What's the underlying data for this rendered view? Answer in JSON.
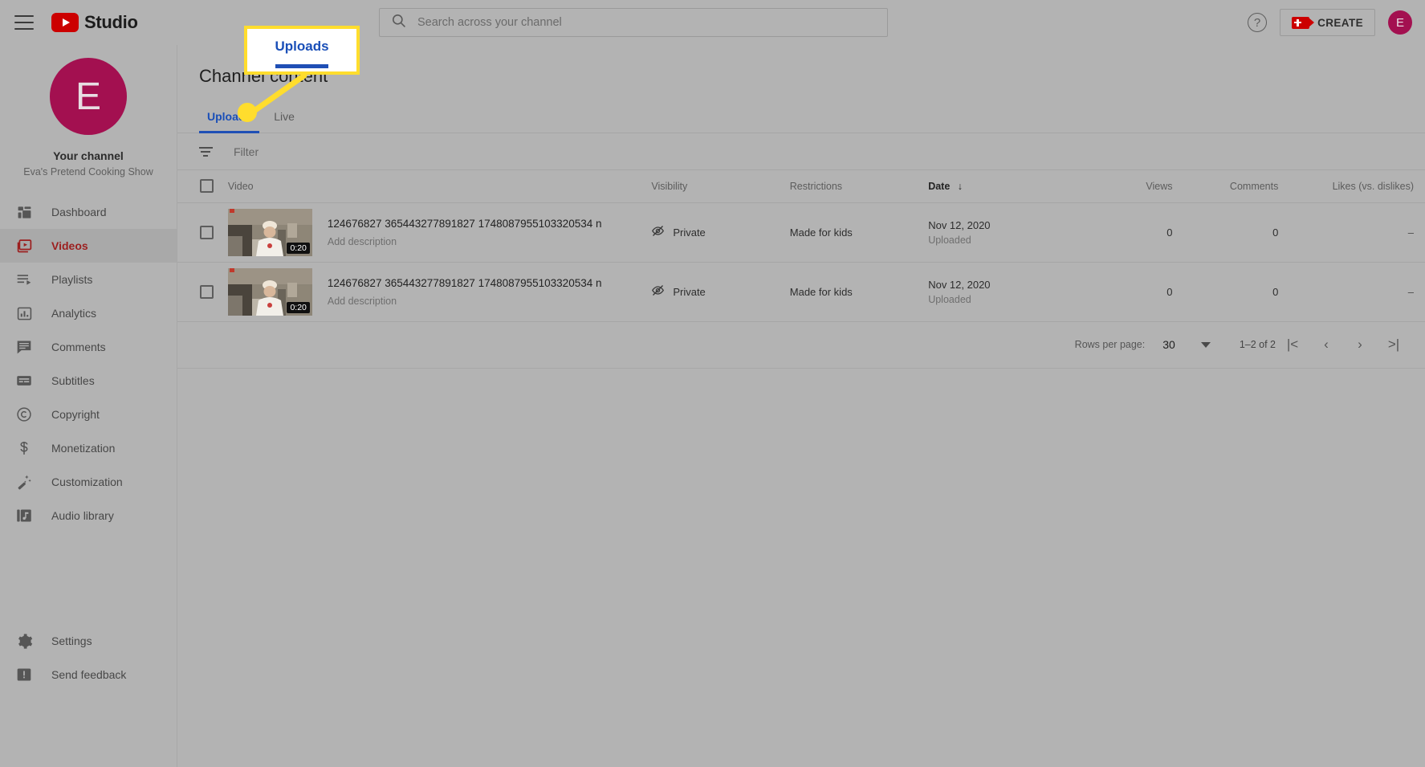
{
  "topbar": {
    "menu_icon": "hamburger-icon",
    "brand": "Studio",
    "search_placeholder": "Search across your channel",
    "search_value": "",
    "help_icon": "question-mark-icon",
    "create_label": "CREATE",
    "avatar_initial": "E"
  },
  "sidebar": {
    "avatar_initial": "E",
    "channel_label": "Your channel",
    "channel_name": "Eva's Pretend Cooking Show",
    "items": [
      {
        "label": "Dashboard",
        "icon": "dashboard-icon",
        "active": false
      },
      {
        "label": "Videos",
        "icon": "video-icon",
        "active": true
      },
      {
        "label": "Playlists",
        "icon": "playlist-icon",
        "active": false
      },
      {
        "label": "Analytics",
        "icon": "analytics-icon",
        "active": false
      },
      {
        "label": "Comments",
        "icon": "comment-icon",
        "active": false
      },
      {
        "label": "Subtitles",
        "icon": "subtitles-icon",
        "active": false
      },
      {
        "label": "Copyright",
        "icon": "copyright-icon",
        "active": false
      },
      {
        "label": "Monetization",
        "icon": "dollar-icon",
        "active": false
      },
      {
        "label": "Customization",
        "icon": "wand-icon",
        "active": false
      },
      {
        "label": "Audio library",
        "icon": "music-note-icon",
        "active": false
      }
    ],
    "bottom_items": [
      {
        "label": "Settings",
        "icon": "gear-icon"
      },
      {
        "label": "Send feedback",
        "icon": "feedback-icon"
      }
    ]
  },
  "main": {
    "page_title": "Channel content",
    "tabs": [
      {
        "label": "Uploads",
        "active": true
      },
      {
        "label": "Live",
        "active": false
      }
    ],
    "filter_placeholder": "Filter",
    "columns": {
      "video": "Video",
      "visibility": "Visibility",
      "restrictions": "Restrictions",
      "date": "Date",
      "date_sort": "↓",
      "views": "Views",
      "comments": "Comments",
      "likes": "Likes (vs. dislikes)"
    },
    "rows": [
      {
        "title": "124676827 365443277891827 1748087955103320534 n",
        "description": "Add description",
        "duration": "0:20",
        "visibility": "Private",
        "restrictions": "Made for kids",
        "date": "Nov 12, 2020",
        "date_state": "Uploaded",
        "views": "0",
        "comments": "0",
        "likes": "–"
      },
      {
        "title": "124676827 365443277891827 1748087955103320534 n",
        "description": "Add description",
        "duration": "0:20",
        "visibility": "Private",
        "restrictions": "Made for kids",
        "date": "Nov 12, 2020",
        "date_state": "Uploaded",
        "views": "0",
        "comments": "0",
        "likes": "–"
      }
    ],
    "pagination": {
      "rows_per_page_label": "Rows per page:",
      "rows_per_page_value": "30",
      "range": "1–2 of 2",
      "first": "|<",
      "prev": "‹",
      "next": "›",
      "last": ">|"
    }
  },
  "callout": {
    "text": "Uploads",
    "border_color": "#ffdd2d",
    "text_color": "#1a4fb8"
  }
}
